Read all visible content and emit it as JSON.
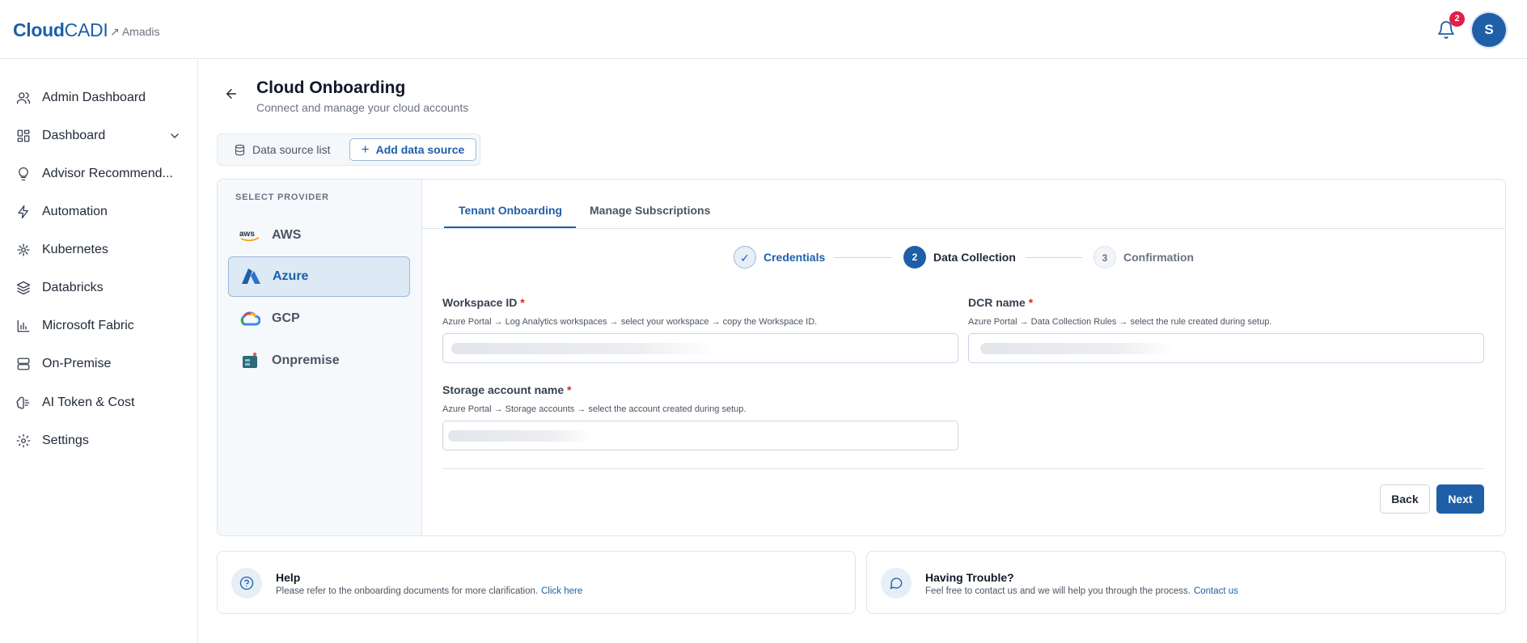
{
  "header": {
    "logo_bold": "Cloud",
    "logo_light": "CADI",
    "tenant": "↗ Amadis",
    "notification_count": "2",
    "avatar_initial": "S"
  },
  "sidebar": {
    "items": [
      {
        "label": "Admin Dashboard",
        "icon": "users-icon"
      },
      {
        "label": "Dashboard",
        "icon": "dashboard-icon"
      },
      {
        "label": "Advisor Recommend...",
        "icon": "lightbulb-icon"
      },
      {
        "label": "Automation",
        "icon": "lightning-icon"
      },
      {
        "label": "Kubernetes",
        "icon": "kubernetes-icon"
      },
      {
        "label": "Databricks",
        "icon": "layers-icon"
      },
      {
        "label": "Microsoft Fabric",
        "icon": "bar-chart-icon"
      },
      {
        "label": "On-Premise",
        "icon": "server-icon"
      },
      {
        "label": "AI Token & Cost",
        "icon": "brain-icon"
      },
      {
        "label": "Settings",
        "icon": "gear-icon"
      }
    ]
  },
  "page": {
    "title": "Cloud Onboarding",
    "subtitle": "Connect and manage your cloud accounts"
  },
  "datasource": {
    "list_label": "Data source list",
    "add_label": "Add data source"
  },
  "providers": {
    "heading": "SELECT PROVIDER",
    "items": [
      {
        "label": "AWS"
      },
      {
        "label": "Azure"
      },
      {
        "label": "GCP"
      },
      {
        "label": "Onpremise"
      }
    ],
    "selected": "Azure"
  },
  "tabs": {
    "tenant": "Tenant Onboarding",
    "subscriptions": "Manage Subscriptions"
  },
  "stepper": {
    "steps": [
      {
        "label": "Credentials",
        "number": "✓",
        "state": "done"
      },
      {
        "label": "Data Collection",
        "number": "2",
        "state": "active"
      },
      {
        "label": "Confirmation",
        "number": "3",
        "state": "pending"
      }
    ]
  },
  "form": {
    "workspace": {
      "label": "Workspace ID",
      "help": "Azure Portal → Log Analytics workspaces → select your workspace → copy the Workspace ID."
    },
    "dcr": {
      "label": "DCR name",
      "help": "Azure Portal → Data Collection Rules → select the rule created during setup."
    },
    "storage": {
      "label": "Storage account name",
      "help": "Azure Portal → Storage accounts → select the account created during setup."
    },
    "required_mark": "*",
    "back_label": "Back",
    "next_label": "Next"
  },
  "help_card": {
    "title": "Help",
    "text": "Please refer to the onboarding documents for more clarification.",
    "link": "Click here"
  },
  "trouble_card": {
    "title": "Having Trouble?",
    "text": "Feel free to contact us and we will help you through the process.",
    "link": "Contact us"
  },
  "colors": {
    "brand": "#1e5fa8",
    "required": "#dc2626",
    "badge": "#e11d48"
  }
}
